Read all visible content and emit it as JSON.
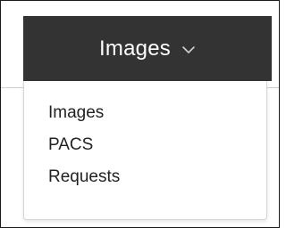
{
  "dropdown": {
    "button_label": "Images",
    "toggle_icon": "chevron-down-icon",
    "items": [
      {
        "label": "Images"
      },
      {
        "label": "PACS"
      },
      {
        "label": "Requests"
      }
    ]
  },
  "colors": {
    "button_bg": "#333333",
    "button_text": "#ffffff",
    "menu_border": "#d6d6d6",
    "item_text": "#222222"
  }
}
